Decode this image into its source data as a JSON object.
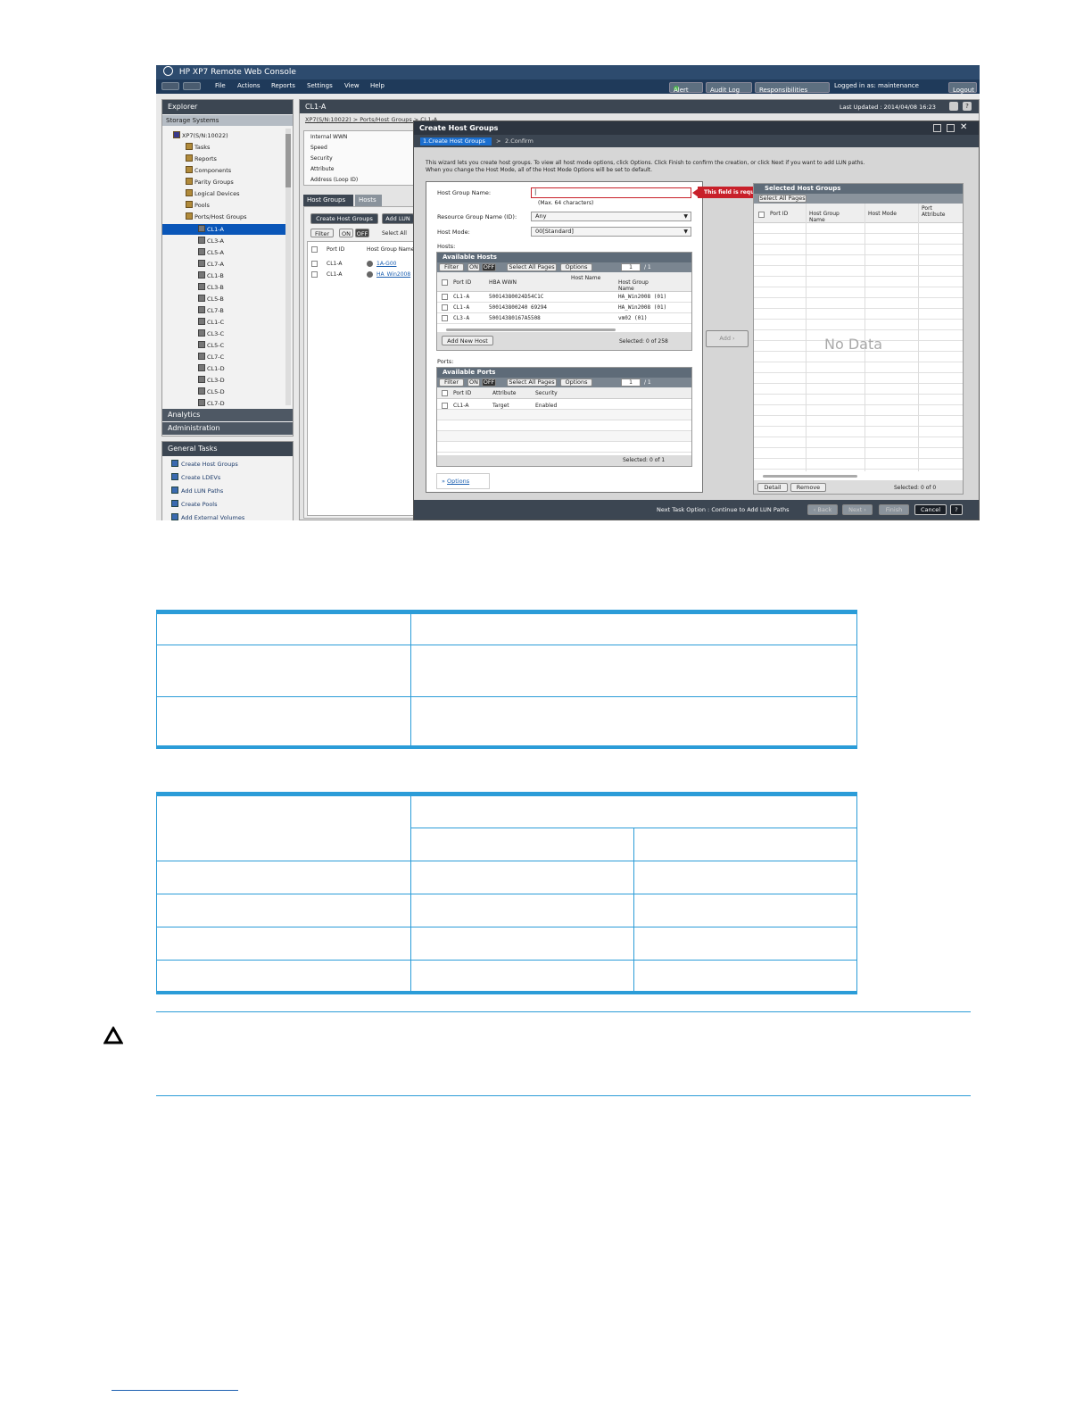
{
  "window": {
    "title": "HP XP7 Remote Web Console",
    "menu": [
      "File",
      "Actions",
      "Reports",
      "Settings",
      "View",
      "Help"
    ],
    "alert_label": "Alert",
    "audit_log_label": "Audit Log",
    "responsibilities_label": "Responsibilities",
    "logged_in": "Logged in as: maintenance",
    "logout_label": "Logout"
  },
  "explorer": {
    "title": "Explorer",
    "storage_systems": "Storage Systems",
    "root": "XP7(S/N:10022)",
    "items": [
      "Tasks",
      "Reports",
      "Components",
      "Parity Groups",
      "Logical Devices",
      "Pools",
      "Ports/Host Groups"
    ],
    "ports": [
      "CL1-A",
      "CL3-A",
      "CL5-A",
      "CL7-A",
      "CL1-B",
      "CL3-B",
      "CL5-B",
      "CL7-B",
      "CL1-C",
      "CL3-C",
      "CL5-C",
      "CL7-C",
      "CL1-D",
      "CL3-D",
      "CL5-D",
      "CL7-D"
    ],
    "analytics": "Analytics",
    "administration": "Administration"
  },
  "general_tasks": {
    "title": "General Tasks",
    "items": [
      "Create Host Groups",
      "Create LDEVs",
      "Add LUN Paths",
      "Create Pools",
      "Add External Volumes"
    ]
  },
  "main": {
    "title": "CL1-A",
    "last_updated": "Last Updated : 2014/04/08 16:23",
    "breadcrumb": "XP7(S/N:10022) > Ports/Host Groups > CL1-A",
    "props": [
      "Internal WWN",
      "Speed",
      "Security",
      "Attribute",
      "Address (Loop ID)"
    ],
    "tabs": [
      "Host Groups",
      "Hosts"
    ],
    "buttons": [
      "Create Host Groups",
      "Add LUN"
    ],
    "filter": "Filter",
    "on": "ON",
    "off": "OFF",
    "select_all": "Select All",
    "col_port": "Port ID",
    "col_hg": "Host Group Name",
    "rows": [
      {
        "port": "CL1-A",
        "hg": "1A-G00"
      },
      {
        "port": "CL1-A",
        "hg": "HA_Win2008"
      }
    ]
  },
  "dialog": {
    "title": "Create Host Groups",
    "step1": "1.Create Host Groups",
    "step_sep": ">",
    "step2": "2.Confirm",
    "intro1": "This wizard lets you create host groups. To view all host mode options, click Options. Click Finish to confirm the creation, or click Next if you want to add LUN paths.",
    "intro2": "When you change the Host Mode, all of the Host Mode Options will be set to default.",
    "hg_name_label": "Host Group Name:",
    "hg_name_value": "|",
    "hg_name_hint": "(Max. 64 characters)",
    "required_msg": "This field is required.",
    "rg_label": "Resource Group Name (ID):",
    "rg_value": "Any",
    "hostmode_label": "Host Mode:",
    "hostmode_value": "00[Standard]",
    "hosts_label": "Hosts:",
    "available_hosts": {
      "title": "Available Hosts",
      "filter": "Filter",
      "on": "ON",
      "off": "OFF",
      "select_all": "Select All Pages",
      "options": "Options",
      "page": "1",
      "page_total": "/ 1",
      "cols": [
        "Port ID",
        "HBA WWN",
        "Host Name",
        "Host Group Name"
      ],
      "rows": [
        [
          "CL1-A",
          "50014380024D54C1C",
          "",
          "HA_Win2008 (01)"
        ],
        [
          "CL1-A",
          "500143800240 69294",
          "",
          "HA_Win2008 (01)"
        ],
        [
          "CL3-A",
          "50014380167A5508",
          "",
          "vm02 (01)"
        ]
      ],
      "add_new_host": "Add New Host",
      "selected": "Selected:",
      "sel_count": "0",
      "sel_of": "of",
      "sel_total": "258"
    },
    "ports_label": "Ports:",
    "available_ports": {
      "title": "Available Ports",
      "filter": "Filter",
      "on": "ON",
      "off": "OFF",
      "select_all": "Select All Pages",
      "options": "Options",
      "page": "1",
      "page_total": "/ 1",
      "cols": [
        "Port ID",
        "Attribute",
        "Security"
      ],
      "rows": [
        [
          "CL1-A",
          "Target",
          "Enabled"
        ]
      ],
      "selected": "Selected:",
      "sel_count": "0",
      "sel_of": "of",
      "sel_total": "1"
    },
    "options_link": "Options",
    "add_button": "Add ›",
    "selected_hg": {
      "title": "Selected Host Groups",
      "select_all": "Select All Pages",
      "cols": [
        "Port ID",
        "Host Group Name",
        "Host Mode",
        "Port Attribute"
      ],
      "no_data": "No Data",
      "detail": "Detail",
      "remove": "Remove",
      "selected": "Selected:",
      "sel_count": "0",
      "sel_of": "of",
      "sel_total": "0"
    },
    "footer": {
      "next_task": "Next Task Option : Continue to Add LUN Paths",
      "back": "‹ Back",
      "next": "Next ›",
      "finish": "Finish",
      "cancel": "Cancel",
      "help": "?"
    }
  },
  "caution_icon": "caution-triangle-icon",
  "colors": {
    "accent": "#2b9cd8",
    "console_header": "#2d4b6e",
    "selection": "#0a56b8",
    "error": "#c8202a"
  }
}
